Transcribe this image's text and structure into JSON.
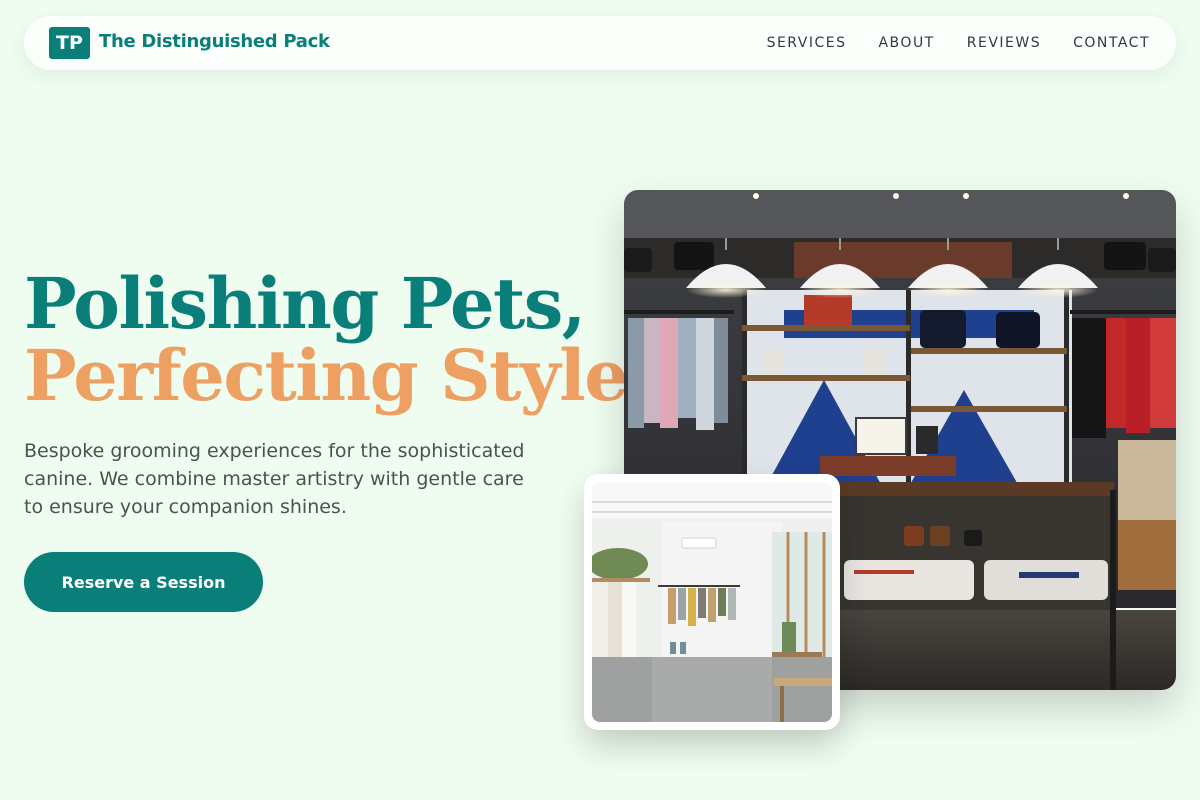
{
  "brand": {
    "logo_initials": "TP",
    "name": "The Distinguished Pack"
  },
  "nav": {
    "items": [
      {
        "label": "SERVICES"
      },
      {
        "label": "ABOUT"
      },
      {
        "label": "REVIEWS"
      },
      {
        "label": "CONTACT"
      }
    ]
  },
  "hero": {
    "title_line1": "Polishing Pets,",
    "title_line2": "Perfecting Style.",
    "description": "Bespoke grooming experiences for the sophisticated canine. We combine master artistry with gentle care to ensure your companion shines.",
    "cta_label": "Reserve a Session"
  },
  "images": {
    "main_alt": "Clothing boutique interior with pendant lamps, shelves and racks",
    "secondary_alt": "Bright minimalist boutique with hanging clothes rack"
  },
  "colors": {
    "brand_teal": "#0a7f7a",
    "accent_orange": "#eea063",
    "page_background": "#effdf1"
  }
}
